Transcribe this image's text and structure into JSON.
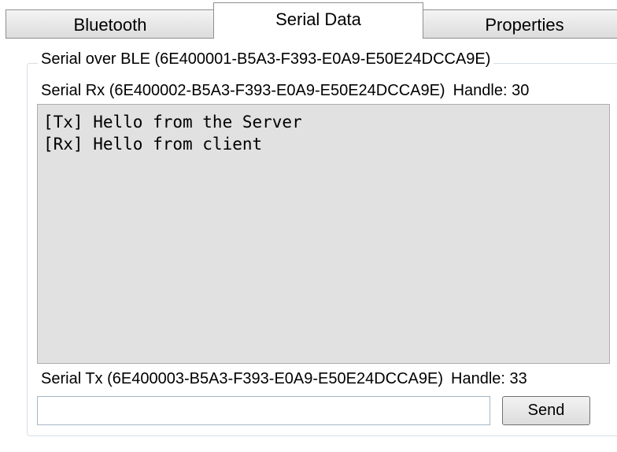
{
  "tabs": [
    {
      "label": "Bluetooth",
      "selected": false
    },
    {
      "label": "Serial Data",
      "selected": true
    },
    {
      "label": "Properties",
      "selected": false
    }
  ],
  "group": {
    "title": "Serial over BLE (6E400001-B5A3-F393-E0A9-E50E24DCCA9E)"
  },
  "rx": {
    "label": "Serial Rx (6E400002-B5A3-F393-E0A9-E50E24DCCA9E)",
    "handle": "Handle: 30",
    "lines": [
      "[Tx] Hello from the Server",
      "[Rx] Hello from client"
    ]
  },
  "tx": {
    "label": "Serial Tx (6E400003-B5A3-F393-E0A9-E50E24DCCA9E)",
    "handle": "Handle: 33",
    "input_value": "",
    "send_label": "Send"
  },
  "colors": {
    "rx_background": "#e1e1e1",
    "selected_tab": "#ffffff",
    "inactive_tab": "#dcdcdc"
  }
}
